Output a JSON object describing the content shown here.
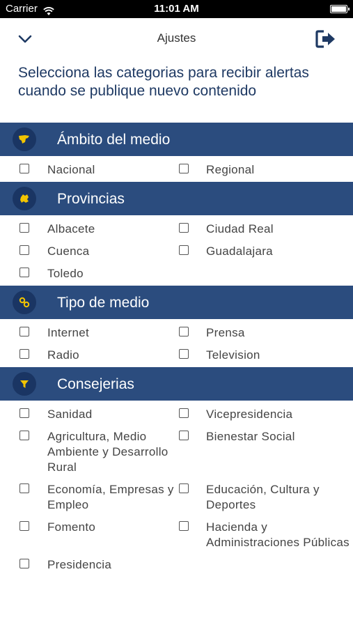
{
  "status_bar": {
    "carrier": "Carrier",
    "time": "11:01 AM"
  },
  "nav": {
    "title": "Ajustes"
  },
  "intro": "Selecciona las categorias para recibir alertas cuando se publique nuevo contenido",
  "icons": {
    "back": "chevron-down-icon",
    "logout": "logout-icon"
  },
  "colors": {
    "header_bg": "#2b4c7e",
    "icon_circle": "#1a3563",
    "icon_fill": "#f2c400",
    "intro_text": "#1e3963"
  },
  "sections": [
    {
      "title": "Ámbito del medio",
      "icon": "map-icon",
      "items": [
        "Nacional",
        "Regional"
      ]
    },
    {
      "title": "Provincias",
      "icon": "region-icon",
      "items": [
        "Albacete",
        "Ciudad Real",
        "Cuenca",
        "Guadalajara",
        "Toledo"
      ]
    },
    {
      "title": "Tipo de medio",
      "icon": "link-icon",
      "items": [
        "Internet",
        "Prensa",
        "Radio",
        "Television"
      ]
    },
    {
      "title": "Consejerias",
      "icon": "filter-icon",
      "items": [
        "Sanidad",
        "Vicepresidencia",
        "Agricultura, Medio Ambiente y Desarrollo Rural",
        "Bienestar Social",
        "Economía, Empresas y Empleo",
        "Educación, Cultura y Deportes",
        "Fomento",
        "Hacienda y Administraciones Públicas",
        "Presidencia"
      ]
    }
  ]
}
